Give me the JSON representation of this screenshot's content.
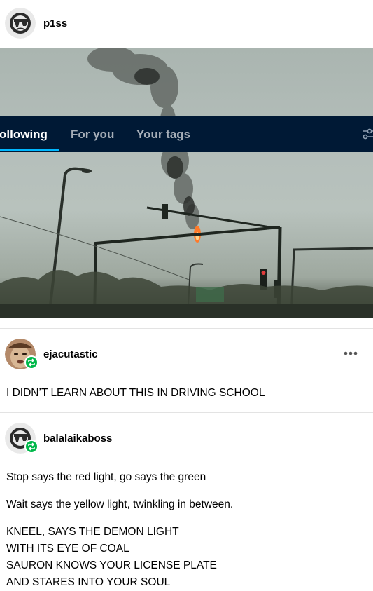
{
  "post_author": {
    "username": "p1ss",
    "avatar_icon": "sunglasses-face-icon"
  },
  "tabs": [
    {
      "label": "ollowing",
      "active": true
    },
    {
      "label": "For you",
      "active": false
    },
    {
      "label": "Your tags",
      "active": false
    }
  ],
  "filter_icon": "sliders-icon",
  "image_icon": "traffic-light-on-fire-photo",
  "reblogs": [
    {
      "username": "ejacutastic",
      "avatar_icon": "photo-avatar-icon",
      "badge_icon": "reblog-icon",
      "paragraphs": [
        "I DIDN’T LEARN ABOUT THIS IN DRIVING SCHOOL"
      ]
    },
    {
      "username": "balalaikaboss",
      "avatar_icon": "sunglasses-face-icon",
      "badge_icon": "reblog-icon",
      "paragraphs": [
        "Stop says the red light, go says the green",
        "Wait says the yellow light, twinkling in between.",
        "KNEEL, SAYS THE DEMON LIGHT",
        "WITH ITS EYE OF COAL",
        "SAURON KNOWS YOUR LICENSE PLATE",
        "AND STARES INTO YOUR SOUL"
      ]
    }
  ],
  "more_icon": "more-options-icon",
  "colors": {
    "tab_bar": "#001935",
    "accent": "#00b8ff",
    "reblog_green": "#00b84a"
  }
}
